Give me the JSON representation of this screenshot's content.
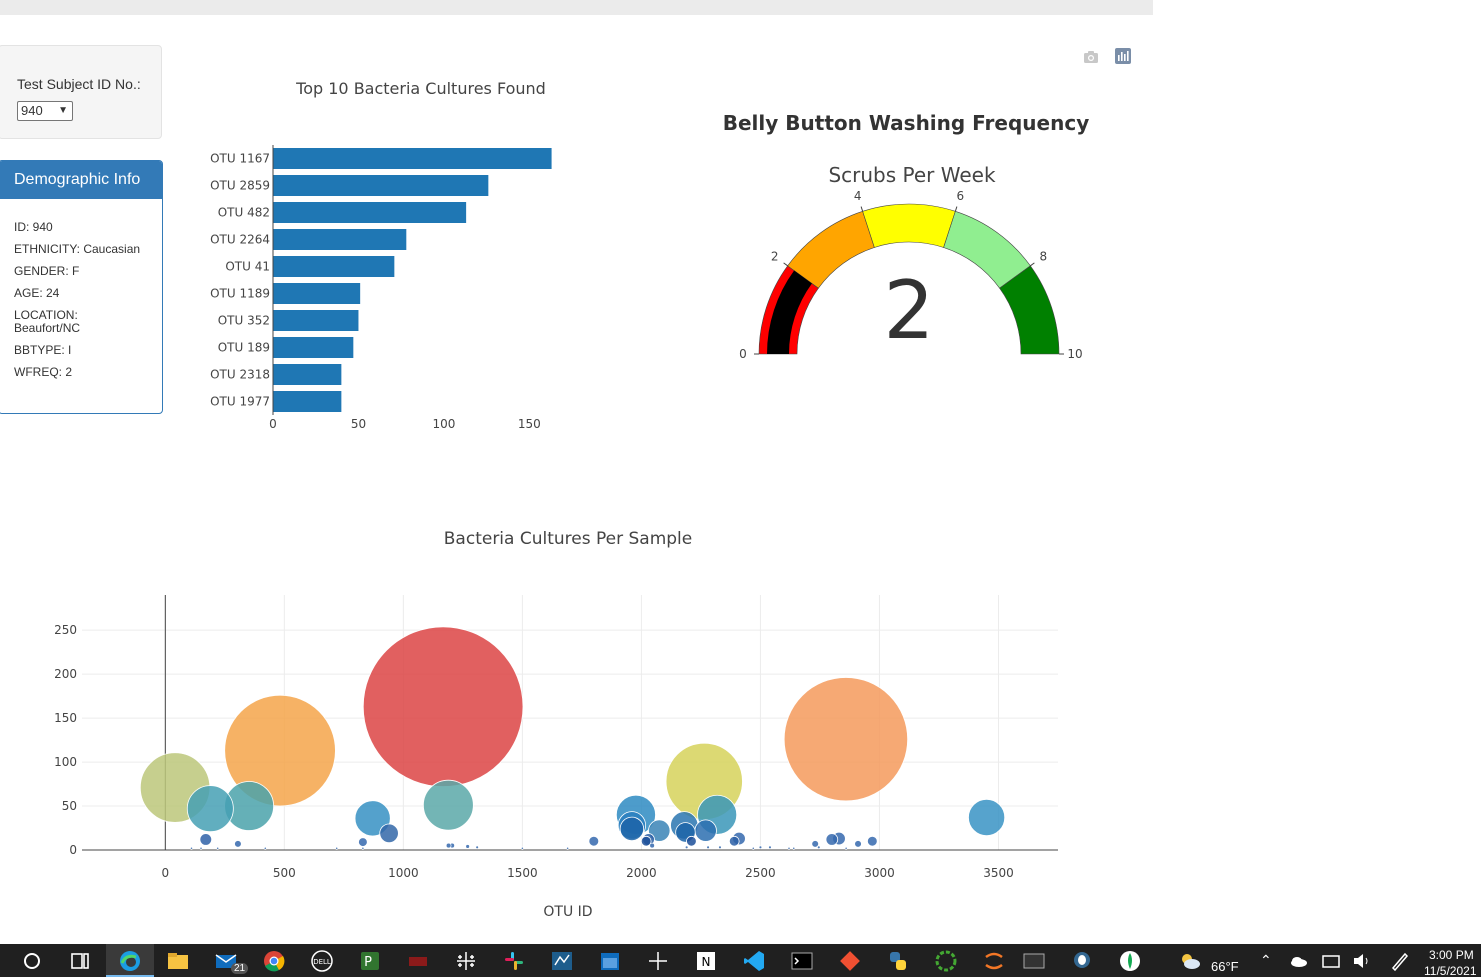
{
  "selector": {
    "label": "Test Subject ID No.:",
    "value": "940"
  },
  "demographics": {
    "title": "Demographic Info",
    "rows": [
      "ID: 940",
      "ETHNICITY: Caucasian",
      "GENDER: F",
      "AGE: 24",
      "LOCATION: Beaufort/NC",
      "BBTYPE: I",
      "WFREQ: 2"
    ]
  },
  "bar_chart": {
    "title": "Top 10 Bacteria Cultures Found"
  },
  "gauge": {
    "title": "Belly Button Washing Frequency",
    "subtitle": "Scrubs Per Week",
    "value_text": "2"
  },
  "bubble_chart": {
    "title": "Bacteria Cultures Per Sample",
    "xlabel": "OTU ID"
  },
  "taskbar": {
    "temperature": "66°F",
    "time": "3:00 PM",
    "date": "11/5/2021",
    "mail_badge": "21"
  },
  "colors": {
    "bar": "#1f77b4",
    "panel_primary": "#337ab7"
  },
  "chart_data": [
    {
      "type": "bar",
      "orientation": "horizontal",
      "title": "Top 10 Bacteria Cultures Found",
      "categories": [
        "OTU 1167",
        "OTU 2859",
        "OTU 482",
        "OTU 2264",
        "OTU 41",
        "OTU 1189",
        "OTU 352",
        "OTU 189",
        "OTU 2318",
        "OTU 1977"
      ],
      "values": [
        163,
        126,
        113,
        78,
        71,
        51,
        50,
        47,
        40,
        40
      ],
      "xticks": [
        "0",
        "50",
        "100",
        "150"
      ],
      "xlim": [
        0,
        165
      ]
    },
    {
      "type": "gauge",
      "title": "Belly Button Washing Frequency",
      "subtitle": "Scrubs Per Week",
      "value": 2,
      "range": [
        0,
        10
      ],
      "ticks": [
        "0",
        "2",
        "4",
        "6",
        "8",
        "10"
      ],
      "steps": [
        {
          "range": [
            0,
            2
          ],
          "color": "#ff0000"
        },
        {
          "range": [
            2,
            4
          ],
          "color": "#ffa500"
        },
        {
          "range": [
            4,
            6
          ],
          "color": "#ffff00"
        },
        {
          "range": [
            6,
            8
          ],
          "color": "#90ee90"
        },
        {
          "range": [
            8,
            10
          ],
          "color": "#008000"
        }
      ],
      "bar_color": "#000000"
    },
    {
      "type": "scatter",
      "mode": "bubble",
      "title": "Bacteria Cultures Per Sample",
      "xlabel": "OTU ID",
      "xlim": [
        -350,
        3750
      ],
      "ylim": [
        0,
        290
      ],
      "xticks": [
        "0",
        "500",
        "1000",
        "1500",
        "2000",
        "2500",
        "3000",
        "3500"
      ],
      "yticks": [
        "0",
        "50",
        "100",
        "150",
        "200",
        "250"
      ],
      "points": [
        {
          "x": 41,
          "y": 71,
          "color": "#bcc77a"
        },
        {
          "x": 482,
          "y": 113,
          "color": "#f5a44a"
        },
        {
          "x": 1167,
          "y": 163,
          "color": "#dc4444"
        },
        {
          "x": 2859,
          "y": 126,
          "color": "#f49a5c"
        },
        {
          "x": 2264,
          "y": 78,
          "color": "#d6d25a"
        },
        {
          "x": 189,
          "y": 47,
          "color": "#45a0b4"
        },
        {
          "x": 352,
          "y": 50,
          "color": "#4aa2aa"
        },
        {
          "x": 1189,
          "y": 51,
          "color": "#5ba8a8"
        },
        {
          "x": 3450,
          "y": 37,
          "color": "#3893c4"
        },
        {
          "x": 871,
          "y": 36,
          "color": "#3690c3"
        },
        {
          "x": 1977,
          "y": 40,
          "color": "#2e8bc2"
        },
        {
          "x": 2318,
          "y": 40,
          "color": "#3a96b8"
        },
        {
          "x": 1960,
          "y": 28,
          "color": "#2a7fbf"
        },
        {
          "x": 2180,
          "y": 28,
          "color": "#2a76b0"
        },
        {
          "x": 2075,
          "y": 22,
          "color": "#3a84b6"
        },
        {
          "x": 1960,
          "y": 24,
          "color": "#1c64a8"
        },
        {
          "x": 940,
          "y": 19,
          "color": "#3367a8"
        },
        {
          "x": 2270,
          "y": 22,
          "color": "#2b6fb0"
        },
        {
          "x": 2185,
          "y": 20,
          "color": "#1c64a8"
        },
        {
          "x": 170,
          "y": 12,
          "color": "#2f62a8"
        },
        {
          "x": 2410,
          "y": 13,
          "color": "#3568ae"
        },
        {
          "x": 2830,
          "y": 13,
          "color": "#3568ae"
        },
        {
          "x": 2800,
          "y": 12,
          "color": "#3568ae"
        },
        {
          "x": 1800,
          "y": 10,
          "color": "#3568ae"
        },
        {
          "x": 2030,
          "y": 12,
          "color": "#2c5fa6"
        },
        {
          "x": 2390,
          "y": 10,
          "color": "#2c5fa6"
        },
        {
          "x": 2210,
          "y": 10,
          "color": "#1c4f99"
        },
        {
          "x": 2020,
          "y": 10,
          "color": "#1c4f99"
        },
        {
          "x": 2970,
          "y": 10,
          "color": "#3568ae"
        },
        {
          "x": 830,
          "y": 9,
          "color": "#3568ae"
        },
        {
          "x": 2730,
          "y": 7,
          "color": "#3568ae"
        },
        {
          "x": 2910,
          "y": 7,
          "color": "#3568ae"
        },
        {
          "x": 305,
          "y": 7,
          "color": "#3568ae"
        },
        {
          "x": 1205,
          "y": 5,
          "color": "#3568ae"
        },
        {
          "x": 1190,
          "y": 5,
          "color": "#3568ae"
        },
        {
          "x": 2045,
          "y": 5,
          "color": "#3568ae"
        },
        {
          "x": 1270,
          "y": 4,
          "color": "#3568ae"
        },
        {
          "x": 1310,
          "y": 3,
          "color": "#3568ae"
        },
        {
          "x": 2190,
          "y": 3,
          "color": "#3568ae"
        },
        {
          "x": 2745,
          "y": 3,
          "color": "#3568ae"
        },
        {
          "x": 2280,
          "y": 3,
          "color": "#3568ae"
        },
        {
          "x": 2330,
          "y": 3,
          "color": "#3568ae"
        },
        {
          "x": 2500,
          "y": 3,
          "color": "#3568ae"
        },
        {
          "x": 2540,
          "y": 3,
          "color": "#3568ae"
        },
        {
          "x": 110,
          "y": 2,
          "color": "#3568ae"
        },
        {
          "x": 150,
          "y": 2,
          "color": "#3568ae"
        },
        {
          "x": 220,
          "y": 2,
          "color": "#3568ae"
        },
        {
          "x": 420,
          "y": 2,
          "color": "#3568ae"
        },
        {
          "x": 720,
          "y": 2,
          "color": "#3568ae"
        },
        {
          "x": 830,
          "y": 2,
          "color": "#3568ae"
        },
        {
          "x": 1500,
          "y": 2,
          "color": "#3568ae"
        },
        {
          "x": 1690,
          "y": 2,
          "color": "#3568ae"
        },
        {
          "x": 2470,
          "y": 2,
          "color": "#3568ae"
        },
        {
          "x": 2620,
          "y": 2,
          "color": "#3568ae"
        },
        {
          "x": 2640,
          "y": 2,
          "color": "#3568ae"
        },
        {
          "x": 2860,
          "y": 2,
          "color": "#3568ae"
        }
      ]
    }
  ]
}
